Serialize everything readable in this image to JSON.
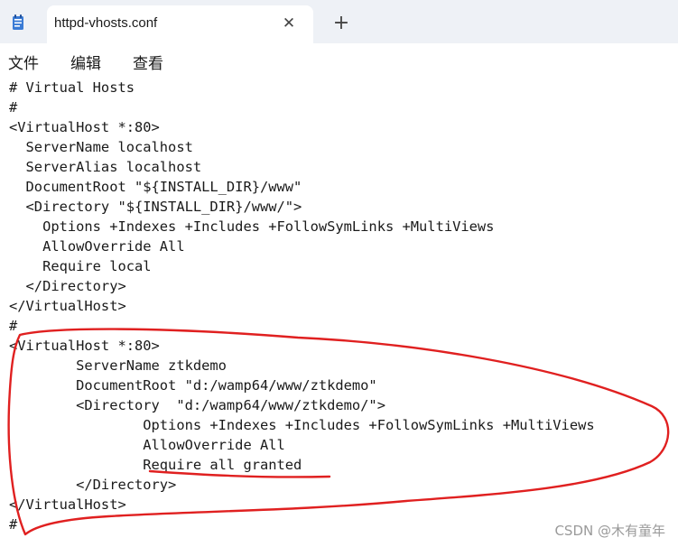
{
  "tab": {
    "title": "httpd-vhosts.conf",
    "close_glyph": "✕",
    "new_tab_glyph": "+",
    "icon": "notepad-icon"
  },
  "menu": {
    "items": [
      {
        "label": "文件"
      },
      {
        "label": "编辑"
      },
      {
        "label": "查看"
      }
    ]
  },
  "editor": {
    "lines": [
      "# Virtual Hosts",
      "#",
      "<VirtualHost *:80>",
      "  ServerName localhost",
      "  ServerAlias localhost",
      "  DocumentRoot \"${INSTALL_DIR}/www\"",
      "  <Directory \"${INSTALL_DIR}/www/\">",
      "    Options +Indexes +Includes +FollowSymLinks +MultiViews",
      "    AllowOverride All",
      "    Require local",
      "  </Directory>",
      "</VirtualHost>",
      "#",
      "<VirtualHost *:80>",
      "        ServerName ztkdemo",
      "        DocumentRoot \"d:/wamp64/www/ztkdemo\"",
      "        <Directory  \"d:/wamp64/www/ztkdemo/\">",
      "                Options +Indexes +Includes +FollowSymLinks +MultiViews",
      "                AllowOverride All",
      "                Require all granted",
      "        </Directory>",
      "</VirtualHost>",
      "#"
    ]
  },
  "annotation": {
    "color": "#e02020"
  },
  "watermark": "CSDN @木有童年"
}
